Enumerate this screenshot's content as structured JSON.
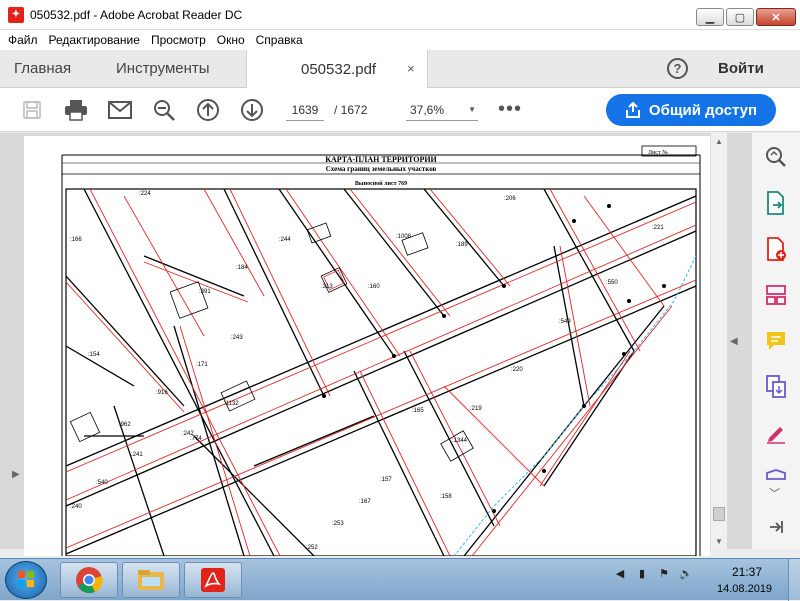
{
  "window": {
    "title": "050532.pdf - Adobe Acrobat Reader DC",
    "app_icon": "acrobat-icon",
    "minimize_icon": "minimize-icon",
    "maximize_icon": "maximize-icon",
    "close_icon": "close-icon"
  },
  "menu": {
    "items": [
      "Файл",
      "Редактирование",
      "Просмотр",
      "Окно",
      "Справка"
    ]
  },
  "tabs": {
    "home": "Главная",
    "tools": "Инструменты",
    "document": "050532.pdf",
    "close_glyph": "×"
  },
  "account": {
    "help_glyph": "?",
    "signin": "Войти"
  },
  "toolbar": {
    "icons": [
      "save-icon",
      "print-icon",
      "email-icon",
      "zoom-search-icon",
      "page-up-icon",
      "page-down-icon"
    ],
    "page_current": "1639",
    "page_total": "/  1672",
    "zoom": "37,6%",
    "more_glyph": "•••",
    "share_label": "Общий доступ"
  },
  "document": {
    "title": "КАРТА-ПЛАН ТЕРРИТОРИИ",
    "subtitle": "Схема границ земельных участков",
    "sheet_label": "Лист №",
    "inset_label": "Выносной лист 769",
    "parcel_labels": [
      ":224",
      ":206",
      ":221",
      ":166",
      ":244",
      ":184",
      ":189",
      ":1008",
      ":313",
      ":160",
      ":550",
      ":549",
      ":154",
      ":391",
      ":243",
      ":171",
      ":220",
      ":916",
      ":1132",
      ":962",
      ":242",
      ":774",
      ":219",
      ":165",
      ":1344",
      ":241",
      ":540",
      ":240",
      ":157",
      ":158",
      ":167",
      ":253",
      ":252"
    ]
  },
  "right_panel": {
    "icons": [
      "enhance-scan-icon",
      "export-pdf-icon",
      "create-pdf-icon",
      "organize-pages-icon",
      "comment-icon",
      "combine-files-icon",
      "fill-sign-icon",
      "protect-icon",
      "collapse-panel-icon"
    ]
  },
  "taskbar": {
    "apps": [
      "chrome-icon",
      "explorer-icon",
      "acrobat-taskbar-icon"
    ],
    "tray_icons": [
      "network-icon",
      "flag-icon",
      "volume-icon"
    ],
    "time": "21:37",
    "date": "14.08.2019"
  },
  "colors": {
    "accent": "#1473e6",
    "adobe_red": "#e2231a",
    "map_red": "#e0282a",
    "map_cyan": "#1fb5e0"
  }
}
